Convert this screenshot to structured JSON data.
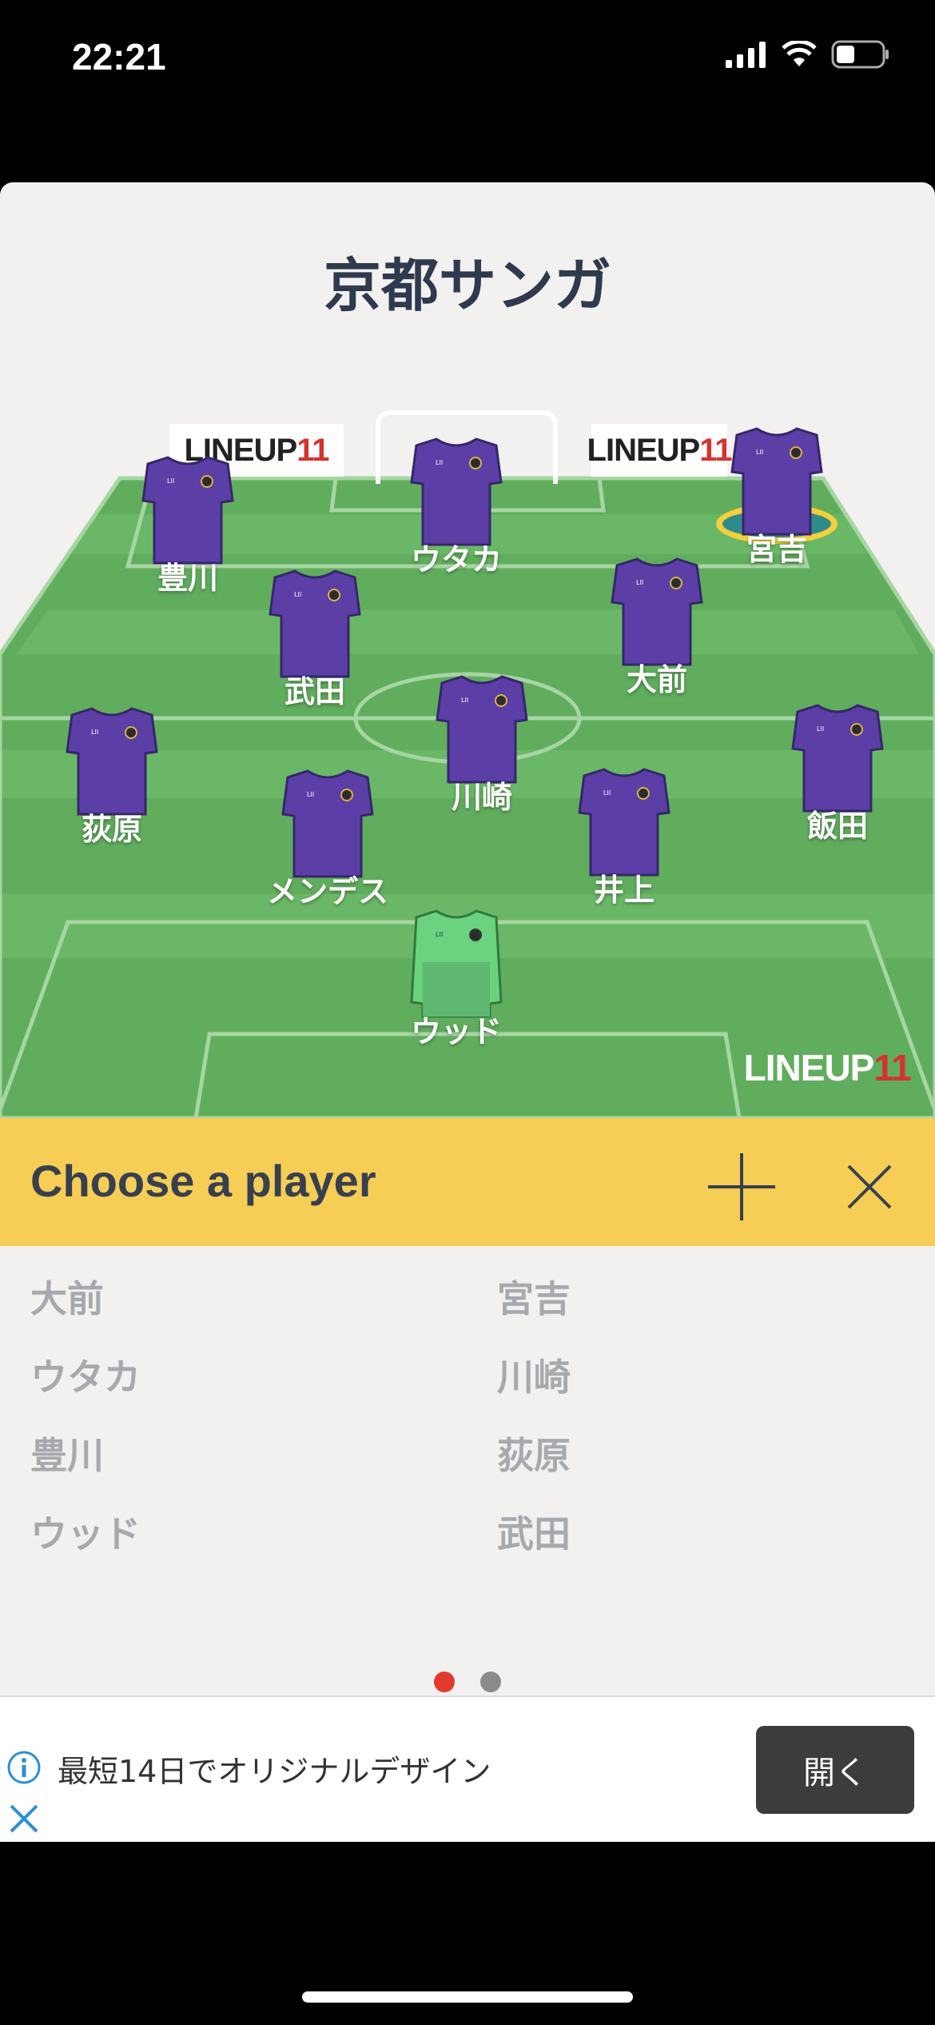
{
  "status_bar": {
    "time": "22:21"
  },
  "team": {
    "name": "京都サンガ"
  },
  "pitch": {
    "ad_board_text": "LINEUP",
    "ad_board_number": "11",
    "logo_text": "LINEUP",
    "logo_number": "11",
    "players": [
      {
        "name": "豊川"
      },
      {
        "name": "ウタカ"
      },
      {
        "name": "宮吉"
      },
      {
        "name": "武田"
      },
      {
        "name": "大前"
      },
      {
        "name": "荻原"
      },
      {
        "name": "川崎"
      },
      {
        "name": "飯田"
      },
      {
        "name": "メンデス"
      },
      {
        "name": "井上"
      },
      {
        "name": "ウッド"
      }
    ],
    "colors": {
      "grass": "#61ad5e",
      "grass_light": "#6fb96c",
      "kit": "#5b3fa6",
      "keeper_kit": "#6bd27f"
    }
  },
  "chooser": {
    "title": "Choose a player",
    "plus_icon": "plus-icon",
    "close_icon": "close-icon",
    "players_left": [
      "大前",
      "ウタカ",
      "豊川",
      "ウッド"
    ],
    "players_right": [
      "宮吉",
      "川崎",
      "荻原",
      "武田"
    ]
  },
  "pagination": {
    "active_color": "#e23a2f",
    "inactive_color": "#8a8a8a"
  },
  "ad": {
    "text": "最短14日でオリジナルデザイン",
    "button_label": "開く"
  }
}
